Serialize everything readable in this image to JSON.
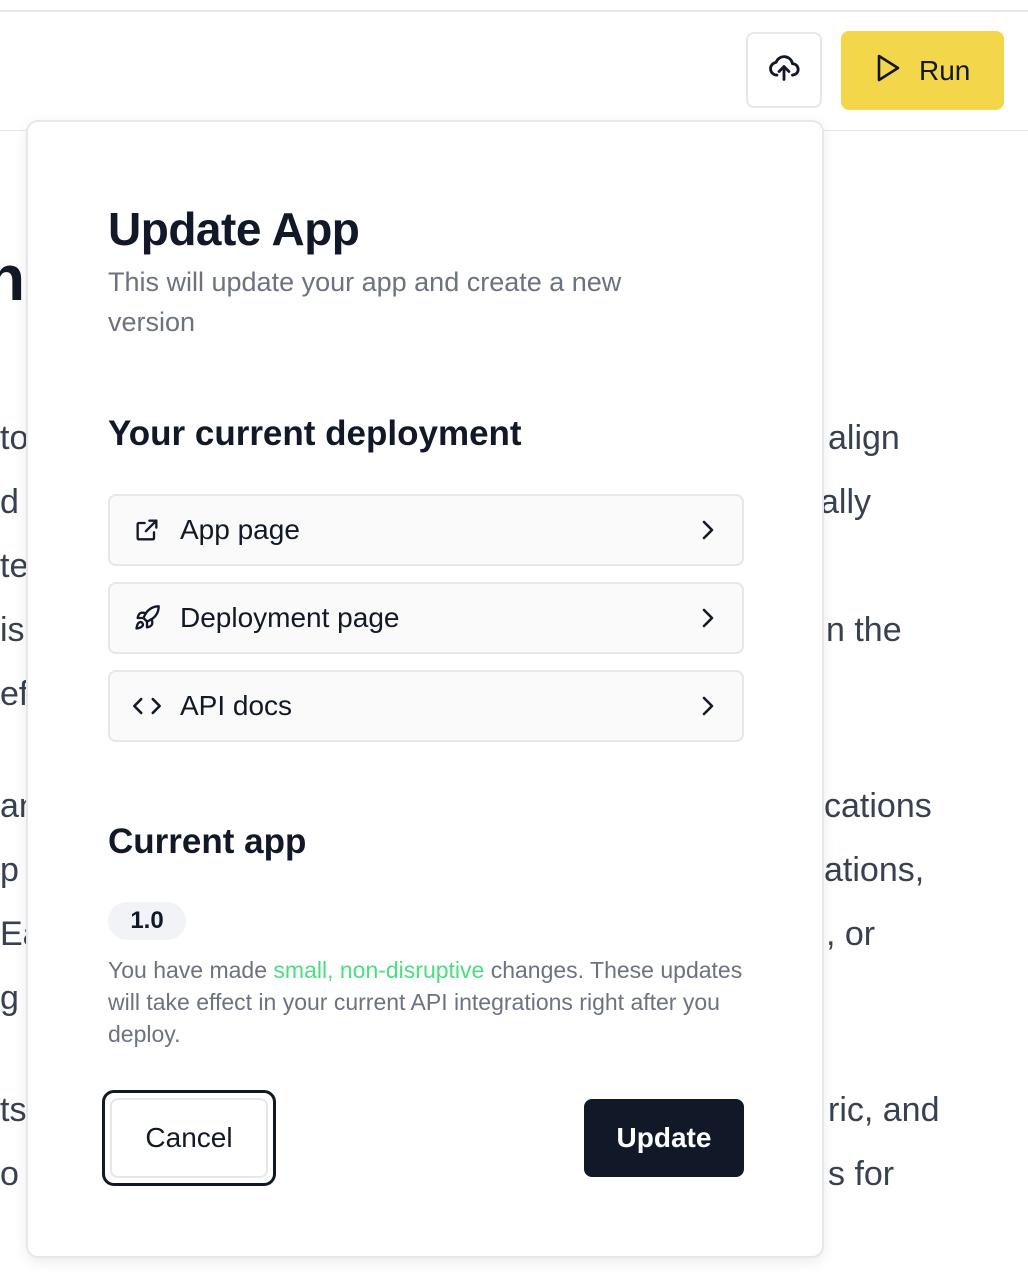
{
  "toolbar": {
    "upload_icon": "cloud-upload-icon",
    "run_label": "Run",
    "run_icon": "play-icon",
    "run_color": "#f4d64a"
  },
  "background": {
    "heading_fragment": "n'",
    "left_fragments": [
      "to",
      "d",
      "te",
      "is",
      "eff",
      "an",
      "p",
      "Ea",
      "g",
      "ts",
      "o"
    ],
    "right_fragments": [
      "align",
      "ally",
      "n the",
      "cations",
      "ations,",
      ", or",
      "ric, and",
      "s for"
    ]
  },
  "modal": {
    "title": "Update App",
    "subtitle": "This will update your app and create a new version",
    "deployment_section_title": "Your current deployment",
    "links": [
      {
        "label": "App page",
        "icon": "external-link-icon"
      },
      {
        "label": "Deployment page",
        "icon": "rocket-icon"
      },
      {
        "label": "API docs",
        "icon": "code-icon"
      }
    ],
    "current_app_title": "Current app",
    "version": "1.0",
    "note_prefix": "You have made ",
    "note_highlight": "small, non-disruptive",
    "note_suffix": " changes. These updates will take effect in your current API integrations right after you deploy.",
    "highlight_color": "#4ade80",
    "cancel_label": "Cancel",
    "update_label": "Update"
  }
}
